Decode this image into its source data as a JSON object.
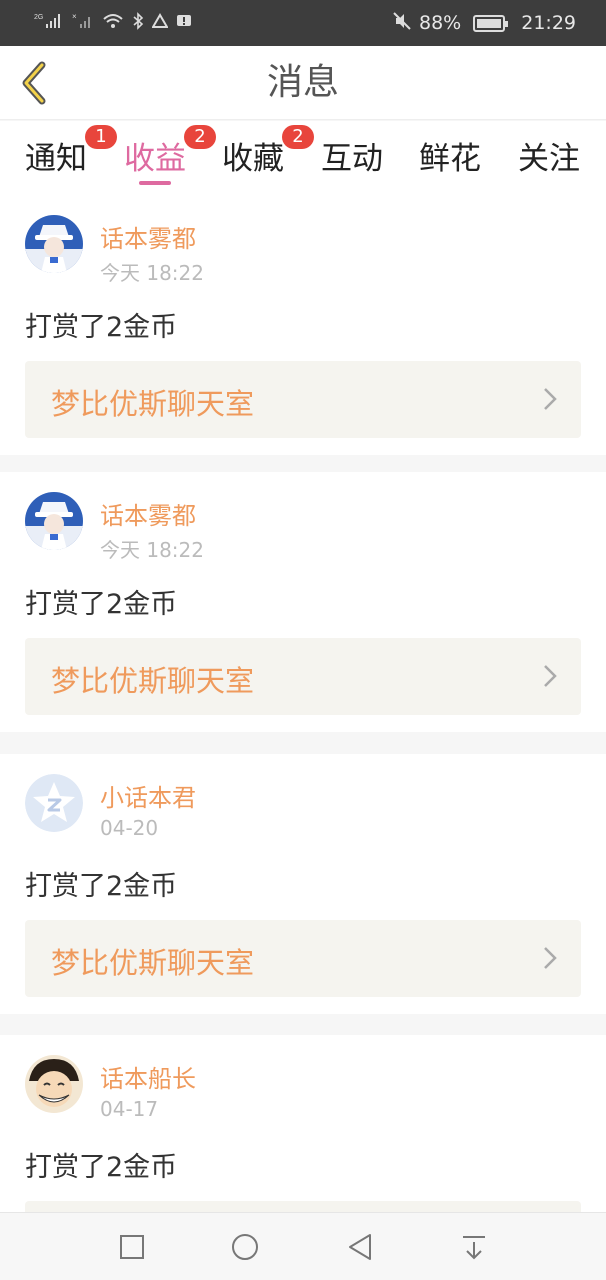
{
  "status_bar": {
    "network_left": "2G",
    "battery": "88%",
    "time": "21:29"
  },
  "header": {
    "title": "消息",
    "back_icon": "chevron-left-icon"
  },
  "tabs": [
    {
      "label": "通知",
      "badge": "1",
      "active": false
    },
    {
      "label": "收益",
      "badge": "2",
      "active": true
    },
    {
      "label": "收藏",
      "badge": "2",
      "active": false
    },
    {
      "label": "互动",
      "badge": "",
      "active": false
    },
    {
      "label": "鲜花",
      "badge": "",
      "active": false
    },
    {
      "label": "关注",
      "badge": "",
      "active": false
    }
  ],
  "messages": [
    {
      "user": "话本雾都",
      "time": "今天 18:22",
      "text": "打赏了2金币",
      "link": "梦比优斯聊天室",
      "avatar": "anime-avatar-white-hat"
    },
    {
      "user": "话本雾都",
      "time": "今天 18:22",
      "text": "打赏了2金币",
      "link": "梦比优斯聊天室",
      "avatar": "anime-avatar-white-hat"
    },
    {
      "user": "小话本君",
      "time": "04-20",
      "text": "打赏了2金币",
      "link": "梦比优斯聊天室",
      "avatar": "official-star-avatar"
    },
    {
      "user": "话本船长",
      "time": "04-17",
      "text": "打赏了2金币",
      "link": "",
      "avatar": "anime-avatar-straw-hat"
    }
  ],
  "colors": {
    "accent_pink": "#de6aa0",
    "username_orange": "#ef9a5c",
    "badge_red": "#e8453c",
    "link_bg": "#f5f4ef"
  }
}
